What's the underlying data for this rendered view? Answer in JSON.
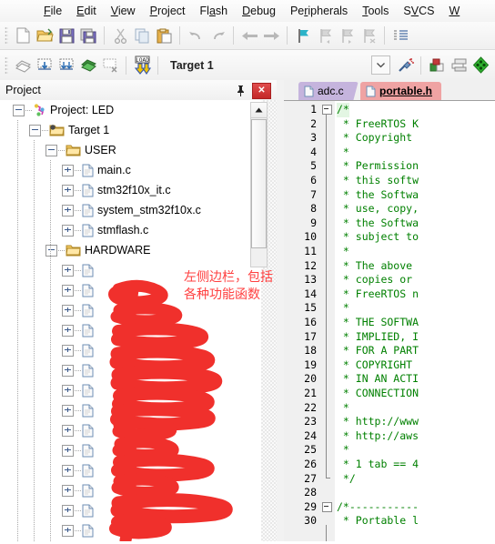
{
  "app": {
    "title": "Keil uVision",
    "accent_red": "#ff3b30",
    "tab_active_color": "#efa3a3",
    "tab_inactive_color": "#c5b4dd",
    "code_comment_color": "#008000"
  },
  "menubar": {
    "items": [
      {
        "label": "File",
        "mnemonic_index": 0
      },
      {
        "label": "Edit",
        "mnemonic_index": 0
      },
      {
        "label": "View",
        "mnemonic_index": 0
      },
      {
        "label": "Project",
        "mnemonic_index": 0
      },
      {
        "label": "Flash",
        "mnemonic_index": 2
      },
      {
        "label": "Debug",
        "mnemonic_index": 0
      },
      {
        "label": "Peripherals",
        "mnemonic_index": 2
      },
      {
        "label": "Tools",
        "mnemonic_index": 0
      },
      {
        "label": "SVCS",
        "mnemonic_index": 1
      },
      {
        "label": "W",
        "mnemonic_index": 0
      }
    ]
  },
  "toolbar_main": {
    "buttons": [
      {
        "name": "new-file-icon",
        "title": "New"
      },
      {
        "name": "open-file-icon",
        "title": "Open"
      },
      {
        "name": "save-icon",
        "title": "Save"
      },
      {
        "name": "save-all-icon",
        "title": "Save All"
      },
      {
        "name": "cut-icon",
        "title": "Cut"
      },
      {
        "name": "copy-icon",
        "title": "Copy"
      },
      {
        "name": "paste-icon",
        "title": "Paste"
      },
      {
        "name": "undo-icon",
        "title": "Undo"
      },
      {
        "name": "redo-icon",
        "title": "Redo"
      },
      {
        "name": "navigate-back-icon",
        "title": "Back"
      },
      {
        "name": "navigate-forward-icon",
        "title": "Forward"
      },
      {
        "name": "bookmark-toggle-icon",
        "title": "Insert/Remove Bookmark"
      },
      {
        "name": "bookmark-prev-icon",
        "title": "Previous Bookmark"
      },
      {
        "name": "bookmark-next-icon",
        "title": "Next Bookmark"
      },
      {
        "name": "bookmark-clear-icon",
        "title": "Clear All Bookmarks"
      },
      {
        "name": "indent-icon",
        "title": "Indent"
      }
    ]
  },
  "toolbar_build": {
    "buttons": [
      {
        "name": "translate-icon",
        "title": "Translate"
      },
      {
        "name": "build-icon",
        "title": "Build"
      },
      {
        "name": "rebuild-icon",
        "title": "Rebuild"
      },
      {
        "name": "batch-build-icon",
        "title": "Batch Build"
      },
      {
        "name": "stop-build-icon",
        "title": "Stop Build"
      },
      {
        "name": "download-icon",
        "title": "Download",
        "glyph": "LOAD"
      }
    ],
    "target_label": "Target 1",
    "target_dropdown": "chevron-down-icon",
    "right_buttons": [
      {
        "name": "target-options-icon",
        "title": "Options for Target"
      },
      {
        "name": "manage-components-icon",
        "title": "Manage Project Items"
      },
      {
        "name": "multi-project-icon",
        "title": "Manage Multi-Project Workspace"
      },
      {
        "name": "pack-installer-icon",
        "title": "Pack Installer"
      }
    ]
  },
  "project_panel": {
    "title": "Project",
    "pin_icon": "pin-icon",
    "close_icon": "close-icon",
    "scroll_up_icon": "scroll-up-arrow-icon",
    "tree": [
      {
        "label": "Project: LED",
        "depth": 0,
        "icon": "project-icon",
        "state": "expanded"
      },
      {
        "label": "Target 1",
        "depth": 1,
        "icon": "target-folder-icon",
        "state": "expanded"
      },
      {
        "label": "USER",
        "depth": 2,
        "icon": "group-folder-icon",
        "state": "expanded"
      },
      {
        "label": "main.c",
        "depth": 3,
        "icon": "c-file-icon",
        "state": "collapsed"
      },
      {
        "label": "stm32f10x_it.c",
        "depth": 3,
        "icon": "c-file-icon",
        "state": "collapsed"
      },
      {
        "label": "system_stm32f10x.c",
        "depth": 3,
        "icon": "c-file-icon",
        "state": "collapsed"
      },
      {
        "label": "stmflash.c",
        "depth": 3,
        "icon": "c-file-icon",
        "state": "collapsed"
      },
      {
        "label": "HARDWARE",
        "depth": 2,
        "icon": "group-folder-icon",
        "state": "expanded"
      },
      {
        "label": "",
        "depth": 3,
        "icon": "c-file-icon",
        "state": "collapsed",
        "redacted": true
      },
      {
        "label": "",
        "depth": 3,
        "icon": "c-file-icon",
        "state": "collapsed",
        "redacted": true
      },
      {
        "label": "",
        "depth": 3,
        "icon": "c-file-icon",
        "state": "collapsed",
        "redacted": true
      },
      {
        "label": "",
        "depth": 3,
        "icon": "c-file-icon",
        "state": "collapsed",
        "redacted": true
      },
      {
        "label": "",
        "depth": 3,
        "icon": "c-file-icon",
        "state": "collapsed",
        "redacted": true
      },
      {
        "label": "",
        "depth": 3,
        "icon": "c-file-icon",
        "state": "collapsed",
        "redacted": true
      },
      {
        "label": "",
        "depth": 3,
        "icon": "c-file-icon",
        "state": "collapsed",
        "redacted": true
      },
      {
        "label": "",
        "depth": 3,
        "icon": "c-file-icon",
        "state": "collapsed",
        "redacted": true
      },
      {
        "label": "",
        "depth": 3,
        "icon": "c-file-icon",
        "state": "collapsed",
        "redacted": true
      },
      {
        "label": "",
        "depth": 3,
        "icon": "c-file-icon",
        "state": "collapsed",
        "redacted": true
      },
      {
        "label": "",
        "depth": 3,
        "icon": "c-file-icon",
        "state": "collapsed",
        "redacted": true
      },
      {
        "label": "",
        "depth": 3,
        "icon": "c-file-icon",
        "state": "collapsed",
        "redacted": true
      },
      {
        "label": "",
        "depth": 3,
        "icon": "c-file-icon",
        "state": "collapsed",
        "redacted": true
      },
      {
        "label": "",
        "depth": 3,
        "icon": "c-file-icon",
        "state": "collapsed",
        "redacted": true
      }
    ]
  },
  "editor": {
    "tabs": [
      {
        "label": "adc.c",
        "active": false,
        "icon": "source-file-icon"
      },
      {
        "label": "portable.h",
        "active": true,
        "icon": "source-file-icon"
      }
    ],
    "lines": [
      {
        "n": 1,
        "text": "/*",
        "fold": "start",
        "highlight": true
      },
      {
        "n": 2,
        "text": " * FreeRTOS K"
      },
      {
        "n": 3,
        "text": " * Copyright"
      },
      {
        "n": 4,
        "text": " *"
      },
      {
        "n": 5,
        "text": " * Permission"
      },
      {
        "n": 6,
        "text": " * this softw"
      },
      {
        "n": 7,
        "text": " * the Softwa"
      },
      {
        "n": 8,
        "text": " * use, copy,"
      },
      {
        "n": 9,
        "text": " * the Softwa"
      },
      {
        "n": 10,
        "text": " * subject to"
      },
      {
        "n": 11,
        "text": " *"
      },
      {
        "n": 12,
        "text": " * The above"
      },
      {
        "n": 13,
        "text": " * copies or"
      },
      {
        "n": 14,
        "text": " * FreeRTOS n"
      },
      {
        "n": 15,
        "text": " *"
      },
      {
        "n": 16,
        "text": " * THE SOFTWA"
      },
      {
        "n": 17,
        "text": " * IMPLIED, I"
      },
      {
        "n": 18,
        "text": " * FOR A PART"
      },
      {
        "n": 19,
        "text": " * COPYRIGHT"
      },
      {
        "n": 20,
        "text": " * IN AN ACTI"
      },
      {
        "n": 21,
        "text": " * CONNECTION"
      },
      {
        "n": 22,
        "text": " *"
      },
      {
        "n": 23,
        "text": " * http://www"
      },
      {
        "n": 24,
        "text": " * http://aws"
      },
      {
        "n": 25,
        "text": " *"
      },
      {
        "n": 26,
        "text": " * 1 tab == 4"
      },
      {
        "n": 27,
        "text": " */",
        "fold": "end"
      },
      {
        "n": 28,
        "text": ""
      },
      {
        "n": 29,
        "text": "/*-----------",
        "fold": "start"
      },
      {
        "n": 30,
        "text": " * Portable l"
      }
    ]
  },
  "annotation": {
    "color": "#ff4040",
    "lines": [
      "左侧边栏，包括",
      "各种功能函数"
    ],
    "scribble_note": "red-marker-redaction-over-hardware-filenames"
  }
}
